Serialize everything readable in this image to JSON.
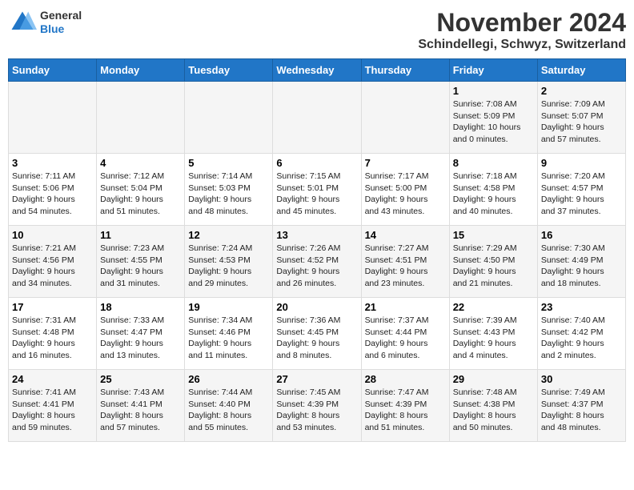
{
  "header": {
    "logo": {
      "general": "General",
      "blue": "Blue"
    },
    "title": "November 2024",
    "subtitle": "Schindellegi, Schwyz, Switzerland"
  },
  "calendar": {
    "days_of_week": [
      "Sunday",
      "Monday",
      "Tuesday",
      "Wednesday",
      "Thursday",
      "Friday",
      "Saturday"
    ],
    "weeks": [
      [
        {
          "day": "",
          "info": ""
        },
        {
          "day": "",
          "info": ""
        },
        {
          "day": "",
          "info": ""
        },
        {
          "day": "",
          "info": ""
        },
        {
          "day": "",
          "info": ""
        },
        {
          "day": "1",
          "info": "Sunrise: 7:08 AM\nSunset: 5:09 PM\nDaylight: 10 hours\nand 0 minutes."
        },
        {
          "day": "2",
          "info": "Sunrise: 7:09 AM\nSunset: 5:07 PM\nDaylight: 9 hours\nand 57 minutes."
        }
      ],
      [
        {
          "day": "3",
          "info": "Sunrise: 7:11 AM\nSunset: 5:06 PM\nDaylight: 9 hours\nand 54 minutes."
        },
        {
          "day": "4",
          "info": "Sunrise: 7:12 AM\nSunset: 5:04 PM\nDaylight: 9 hours\nand 51 minutes."
        },
        {
          "day": "5",
          "info": "Sunrise: 7:14 AM\nSunset: 5:03 PM\nDaylight: 9 hours\nand 48 minutes."
        },
        {
          "day": "6",
          "info": "Sunrise: 7:15 AM\nSunset: 5:01 PM\nDaylight: 9 hours\nand 45 minutes."
        },
        {
          "day": "7",
          "info": "Sunrise: 7:17 AM\nSunset: 5:00 PM\nDaylight: 9 hours\nand 43 minutes."
        },
        {
          "day": "8",
          "info": "Sunrise: 7:18 AM\nSunset: 4:58 PM\nDaylight: 9 hours\nand 40 minutes."
        },
        {
          "day": "9",
          "info": "Sunrise: 7:20 AM\nSunset: 4:57 PM\nDaylight: 9 hours\nand 37 minutes."
        }
      ],
      [
        {
          "day": "10",
          "info": "Sunrise: 7:21 AM\nSunset: 4:56 PM\nDaylight: 9 hours\nand 34 minutes."
        },
        {
          "day": "11",
          "info": "Sunrise: 7:23 AM\nSunset: 4:55 PM\nDaylight: 9 hours\nand 31 minutes."
        },
        {
          "day": "12",
          "info": "Sunrise: 7:24 AM\nSunset: 4:53 PM\nDaylight: 9 hours\nand 29 minutes."
        },
        {
          "day": "13",
          "info": "Sunrise: 7:26 AM\nSunset: 4:52 PM\nDaylight: 9 hours\nand 26 minutes."
        },
        {
          "day": "14",
          "info": "Sunrise: 7:27 AM\nSunset: 4:51 PM\nDaylight: 9 hours\nand 23 minutes."
        },
        {
          "day": "15",
          "info": "Sunrise: 7:29 AM\nSunset: 4:50 PM\nDaylight: 9 hours\nand 21 minutes."
        },
        {
          "day": "16",
          "info": "Sunrise: 7:30 AM\nSunset: 4:49 PM\nDaylight: 9 hours\nand 18 minutes."
        }
      ],
      [
        {
          "day": "17",
          "info": "Sunrise: 7:31 AM\nSunset: 4:48 PM\nDaylight: 9 hours\nand 16 minutes."
        },
        {
          "day": "18",
          "info": "Sunrise: 7:33 AM\nSunset: 4:47 PM\nDaylight: 9 hours\nand 13 minutes."
        },
        {
          "day": "19",
          "info": "Sunrise: 7:34 AM\nSunset: 4:46 PM\nDaylight: 9 hours\nand 11 minutes."
        },
        {
          "day": "20",
          "info": "Sunrise: 7:36 AM\nSunset: 4:45 PM\nDaylight: 9 hours\nand 8 minutes."
        },
        {
          "day": "21",
          "info": "Sunrise: 7:37 AM\nSunset: 4:44 PM\nDaylight: 9 hours\nand 6 minutes."
        },
        {
          "day": "22",
          "info": "Sunrise: 7:39 AM\nSunset: 4:43 PM\nDaylight: 9 hours\nand 4 minutes."
        },
        {
          "day": "23",
          "info": "Sunrise: 7:40 AM\nSunset: 4:42 PM\nDaylight: 9 hours\nand 2 minutes."
        }
      ],
      [
        {
          "day": "24",
          "info": "Sunrise: 7:41 AM\nSunset: 4:41 PM\nDaylight: 8 hours\nand 59 minutes."
        },
        {
          "day": "25",
          "info": "Sunrise: 7:43 AM\nSunset: 4:41 PM\nDaylight: 8 hours\nand 57 minutes."
        },
        {
          "day": "26",
          "info": "Sunrise: 7:44 AM\nSunset: 4:40 PM\nDaylight: 8 hours\nand 55 minutes."
        },
        {
          "day": "27",
          "info": "Sunrise: 7:45 AM\nSunset: 4:39 PM\nDaylight: 8 hours\nand 53 minutes."
        },
        {
          "day": "28",
          "info": "Sunrise: 7:47 AM\nSunset: 4:39 PM\nDaylight: 8 hours\nand 51 minutes."
        },
        {
          "day": "29",
          "info": "Sunrise: 7:48 AM\nSunset: 4:38 PM\nDaylight: 8 hours\nand 50 minutes."
        },
        {
          "day": "30",
          "info": "Sunrise: 7:49 AM\nSunset: 4:37 PM\nDaylight: 8 hours\nand 48 minutes."
        }
      ]
    ]
  }
}
